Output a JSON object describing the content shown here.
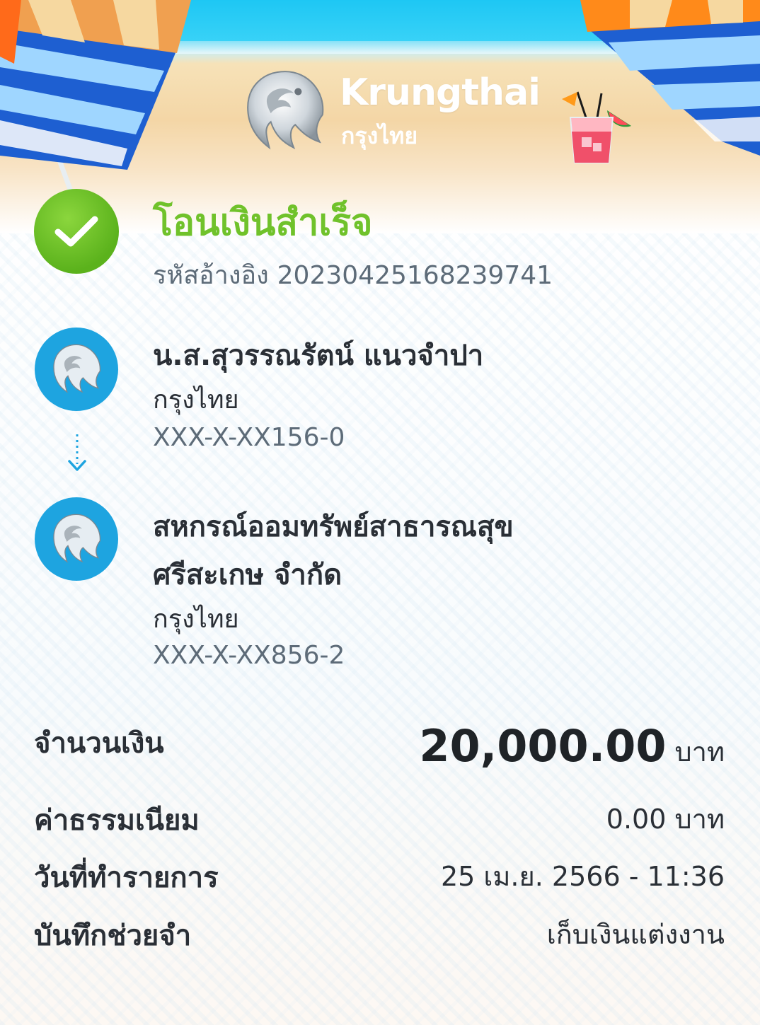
{
  "brand": {
    "name_en": "Krungthai",
    "name_th": "กรุงไทย"
  },
  "status": {
    "title": "โอนเงินสำเร็จ",
    "reference_label": "รหัสอ้างอิง",
    "reference_number": "2023042516823974",
    "reference_number_suffix": "1"
  },
  "sender": {
    "name": "น.ส.สุวรรณรัตน์ แนวจำปา",
    "bank": "กรุงไทย",
    "account": "XXX-X-XX156-0"
  },
  "receiver": {
    "name_line1": "สหกรณ์ออมทรัพย์สาธารณสุข",
    "name_line2": "ศรีสะเกษ จำกัด",
    "bank": "กรุงไทย",
    "account": "XXX-X-XX856-2"
  },
  "details": {
    "amount_label": "จำนวนเงิน",
    "amount_value": "20,000.00",
    "amount_unit": "บาท",
    "fee_label": "ค่าธรรมเนียม",
    "fee_value": "0.00 บาท",
    "date_label": "วันที่ทำรายการ",
    "date_value": "25 เม.ย. 2566 - 11:36",
    "memo_label": "บันทึกช่วยจำ",
    "memo_value": "เก็บเงินแต่งงาน"
  },
  "colors": {
    "success_green": "#70c22b",
    "bank_blue": "#1ea4e0",
    "text_dark": "#2a2f36",
    "text_muted": "#5d6b78"
  },
  "icons": [
    "krungthai-logo-icon",
    "drink-icon",
    "check-icon",
    "bank-logo-icon",
    "arrow-down-icon"
  ]
}
